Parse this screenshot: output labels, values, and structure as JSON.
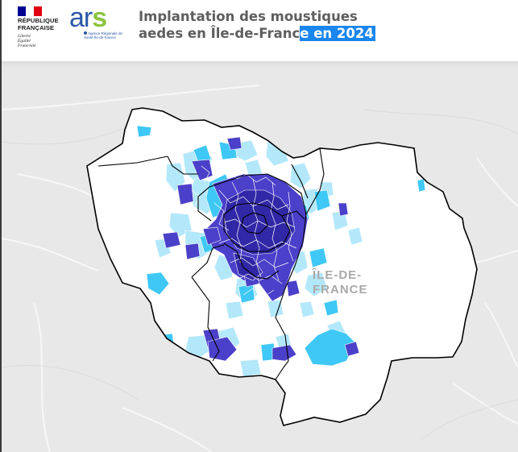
{
  "header": {
    "logo_rf": {
      "name_lines": [
        "RÉPUBLIQUE",
        "FRANÇAISE"
      ],
      "motto_lines": [
        "Liberté",
        "Égalité",
        "Fraternité"
      ],
      "flag_colors": [
        "#000091",
        "#ffffff",
        "#e1000f"
      ]
    },
    "logo_ars": {
      "letters": "ars",
      "subtitle": "Agence Régionale de Santé Île-de-France",
      "colors": {
        "primary": "#2b57a7",
        "accent": "#8cc43f"
      }
    },
    "title": {
      "line1": "Implantation des moustiques",
      "line2_before": "aedes en Île-de-Franc",
      "line2_highlight": "e en 2024"
    }
  },
  "map": {
    "region_label_lines": [
      "ÎLE-DE-",
      "FRANCE"
    ],
    "colors": {
      "background": "#e8e8e8",
      "region_fill": "#ffffff",
      "light": "#b3e8fa",
      "medium": "#3fc8f5",
      "dark": "#4b40c9",
      "darkest": "#3028a6",
      "border": "#000000"
    }
  }
}
